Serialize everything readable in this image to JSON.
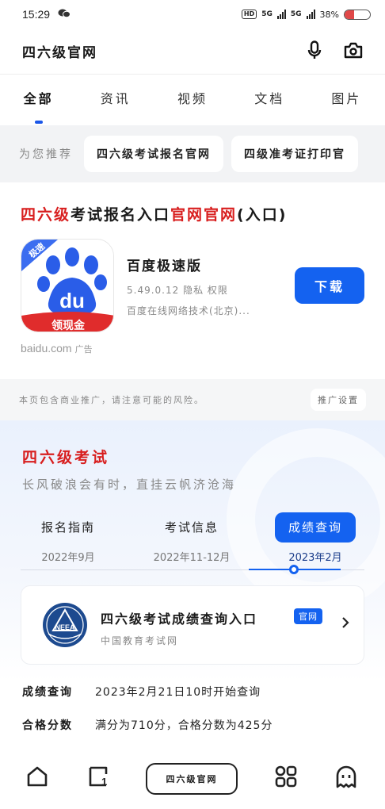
{
  "status_bar": {
    "time": "15:29",
    "hd_label": "HD",
    "network_1": "5G",
    "network_2": "5G",
    "battery_text": "38%",
    "battery_level": 0.38
  },
  "header": {
    "title": "四六级官网"
  },
  "tabs": [
    {
      "label": "全部",
      "active": true
    },
    {
      "label": "资讯",
      "active": false
    },
    {
      "label": "视频",
      "active": false
    },
    {
      "label": "文档",
      "active": false
    },
    {
      "label": "图片",
      "active": false
    }
  ],
  "recommend": {
    "label": "为您推荐",
    "chips": [
      "四六级考试报名官网",
      "四级准考证打印官"
    ]
  },
  "ad": {
    "title_part1": "四六级",
    "title_part2": "考试报名入口",
    "title_part3": "官网官网",
    "title_part4": "(入口)",
    "app_name": "百度极速版",
    "app_meta": "5.49.0.12 隐私 权限",
    "app_developer": "百度在线网络技术(北京)...",
    "download_label": "下载",
    "source": "baidu.com",
    "ad_tag": "广告",
    "icon_badge": "极速",
    "icon_banner": "领现金",
    "icon_text": "du"
  },
  "notice": {
    "text": "本页包含商业推广，请注意可能的风险。",
    "button": "推广设置"
  },
  "exam": {
    "title": "四六级考试",
    "subtitle": "长风破浪会有时，直挂云帆济沧海",
    "tabs": [
      {
        "name": "报名指南",
        "date": "2022年9月",
        "active": false
      },
      {
        "name": "考试信息",
        "date": "2022年11-12月",
        "active": false
      },
      {
        "name": "成绩查询",
        "date": "2023年2月",
        "active": true
      }
    ],
    "card": {
      "title": "四六级考试成绩查询入口",
      "badge": "官网",
      "org": "中国教育考试网",
      "logo_text": "NEEA"
    }
  },
  "info": [
    {
      "label": "成绩查询",
      "value": "2023年2月21日10时开始查询"
    },
    {
      "label": "合格分数",
      "value": "满分为710分，合格分数为425分"
    }
  ],
  "bottom_nav": {
    "center_label": "四六级官网",
    "tabs_count": "1"
  },
  "colors": {
    "accent": "#1462f0",
    "red": "#d81e1e"
  }
}
